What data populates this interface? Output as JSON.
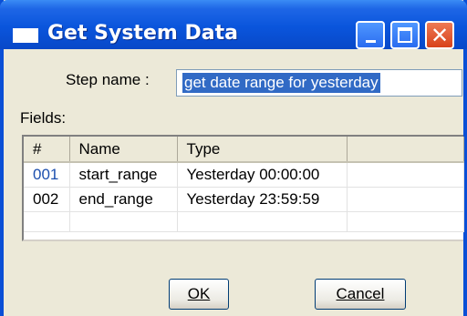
{
  "window": {
    "title": "Get System Data"
  },
  "title_buttons": {
    "minimize_icon": "minimize-icon",
    "maximize_icon": "maximize-icon",
    "close_icon": "close-icon",
    "close_glyph": "✕"
  },
  "form": {
    "step_name_label": "Step name :",
    "step_name_value": "get date range for yesterday",
    "fields_label": "Fields:"
  },
  "table": {
    "columns": [
      "#",
      "Name",
      "Type",
      ""
    ],
    "rows": [
      {
        "num": "001",
        "name": "start_range",
        "type": "Yesterday 00:00:00"
      },
      {
        "num": "002",
        "name": "end_range",
        "type": "Yesterday 23:59:59"
      }
    ]
  },
  "buttons": {
    "ok": "OK",
    "cancel": "Cancel"
  },
  "colors": {
    "titlebar": "#0a55dc",
    "dialog_bg": "#ece9d8",
    "selection": "#316ac5",
    "row_number": "#1c4fae"
  }
}
